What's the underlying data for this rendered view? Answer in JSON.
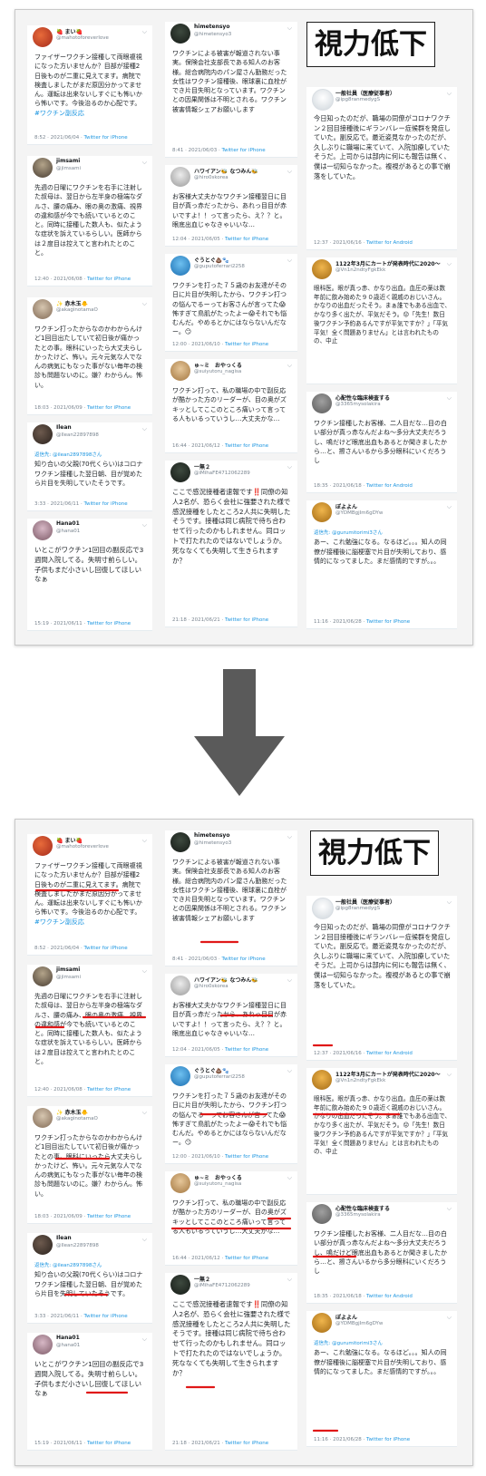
{
  "title": "視力低下",
  "via": "Twitter for iPhone",
  "via_android": "Twitter for Android",
  "tweets": [
    {
      "name": "🍓 まい🍓",
      "handle": "@mahotoforeverlove",
      "text": "ファイザーワクチン接種して両眼複視になった方いませんか？目部が接種2日後ものが二重に見えてます。病院で検査しましたがまだ原因分かってません。運転は出来ないしすぐにも怖いから怖いです。今後治るのか心配です。",
      "tag": "#ワクチン副反応",
      "time": "8:52 · 2021/06/04"
    },
    {
      "name": "jimsami",
      "handle": "@jimsami",
      "text": "先週の日曜にワクチンを右手に注射した叔母は、翌日から左半身の極端なダルさ、腰の痛み、眼の奥の激痛、視界の違和感が今でも続いているとのこと。同時に接種した数人も、似たような症状を訴えているらしい。医師からは２度目は控えてと言われたとのこと。",
      "time": "12:40 · 2021/06/08"
    },
    {
      "name": "✨ 赤木玉🐥",
      "handle": "@akaginotamaO",
      "text": "ワクチン打ったからなのかわからんけど1回目出たしていて初日後が痛かったとの事。眼科にいったら大丈夫らしかったけど、怖い。元々元気な人でなんの病気にもなった事がない毎年の検診も問題ないのに。嫌？わからん。怖い。",
      "time": "18:03 · 2021/06/09"
    },
    {
      "name": "Ilean",
      "handle": "@Ilean22897898",
      "reply": "返信先: @ilean2897898さん",
      "text": "知り合いの父親(70代くらい)はコロナワクチン接種した翌日朝、目が覚めたら片目を失明していたそうです。",
      "time": "3:33 · 2021/06/11"
    },
    {
      "name": "Hana01",
      "handle": "@hana01",
      "text": "いとこがワクチン1回目の副反応で3週間入院してる。失明寸前らしい。子供もまだ小さいし回復してほしいなぁ",
      "time": "15:19 · 2021/06/11"
    },
    {
      "name": "himetensyo",
      "handle": "@himetensyo3",
      "text": "ワクチンによる被害が報道されない事実。保険会社支部長である知人のお客様。総合病院内のパン屋さん勤務だった女性はワクチン接種後、眼球裏に血栓ができ片目失明となっています。ワクチンとの因果関係は不明とされる。ワクチン被害情報シェアお願いします",
      "time": "8:41 · 2021/06/03"
    },
    {
      "name": "ハワイアン🐝 なつみん🐝",
      "handle": "@hiro0skorea",
      "text": "お客様大丈夫かなワクチン接種翌日に目目が真っ赤だったから、あれっ目目が赤いですよ！！って言ったら、え？？と。眼底出血じゃなきゃいいな…",
      "time": "12:04 · 2021/06/05"
    },
    {
      "name": "ぐうとぐ💩🐾",
      "handle": "@guputoferrari2258",
      "text": "ワクチンを打った７５歳のお友達がその日に片目が失明したから、ワクチン打つの悩んでるーってお客さんが言ってた😱怖すぎて鳥肌がたったよー😱それでも悩むんだ。やめるとかにはならないんだなー。😏",
      "time": "12:00 · 2021/06/10"
    },
    {
      "name": "ゅ~ミ　おやっくる",
      "handle": "@suiyutoru_nagisa",
      "text": "ワクチン打って、私の職場の中で副反応が酷かった方のリーダーが、目の奥がズキッとしてここのところ痛いって言ってる人もいるっていうし…大丈夫かな…",
      "time": "16:44 · 2021/06/12"
    },
    {
      "name": "一無２",
      "handle": "@iMihaFE4712062289",
      "text": "ここで感況接種者速報です‼️同僚の知人2名が、恐らく会社に強要された様で感況接種をしたところ2人共に失明したそうです。接種は同じ病院で待ち合わせて行ったのかもしれません。同ロットで打たれたのではないでしょうか。死ななくても失明して生きられますか？",
      "time": "21:18 · 2021/06/21"
    },
    {
      "name": "一般社員（医療従事者）",
      "handle": "@ipg8ranmedygS",
      "text": "今日知ったのだが、職場の同僚がコロナワクチン２回目接種後にギランバレー症候群を発症していた。副反応で。最近姿見なかったのだが、久しぶりに職場に来ていて、入院加療していたそうだ。上司からは部内に何にも報告は無く、僕は一切知らなかった。複視があるとの事で崩落をしていた。",
      "time": "12:37 · 2021/06/16"
    },
    {
      "name": "1122年3月にカートが発表時代に2020～",
      "handle": "@Vn1n2ndtyFgkEkk",
      "text": "眼科医。眼が真っ赤、かなり出血。血圧の薬は数年前に飲み始めた９０歳近く親戚のおじいさん。かなりの出血だったそう。まぁ誰でもある出血で、かなり多く出たが、平気だそう。😟「先生！数日後ワクチン予約あるんですが平気ですか？」「平気平気！全く問題ありません」とは言われたものの、中止",
      "time": ""
    },
    {
      "name": "心配性な臨床検査する",
      "handle": "@3365mysolakira",
      "text": "ワクチン接種したお客様、二人目だな…目の白い部分が真っ赤なんだよね〜多分大丈夫だろうし、鳴だけど眼底出血もあるとか聞きましたから…と、擦さんいるから多分眼科にいくだろうし",
      "time": "18:35 · 2021/06/18"
    },
    {
      "name": "ぽよよん",
      "handle": "@YDMBgjIm6gDYw",
      "reply": "返信先: @gurumitorimi3さん",
      "text": "あー、これ勉強になる。なるほど。。。知人の同僚が接種後に脳梗塞で片目が失明しており、感情的になってました。まだ感情的ですが。。。",
      "time": "11:16 · 2021/06/28"
    }
  ]
}
